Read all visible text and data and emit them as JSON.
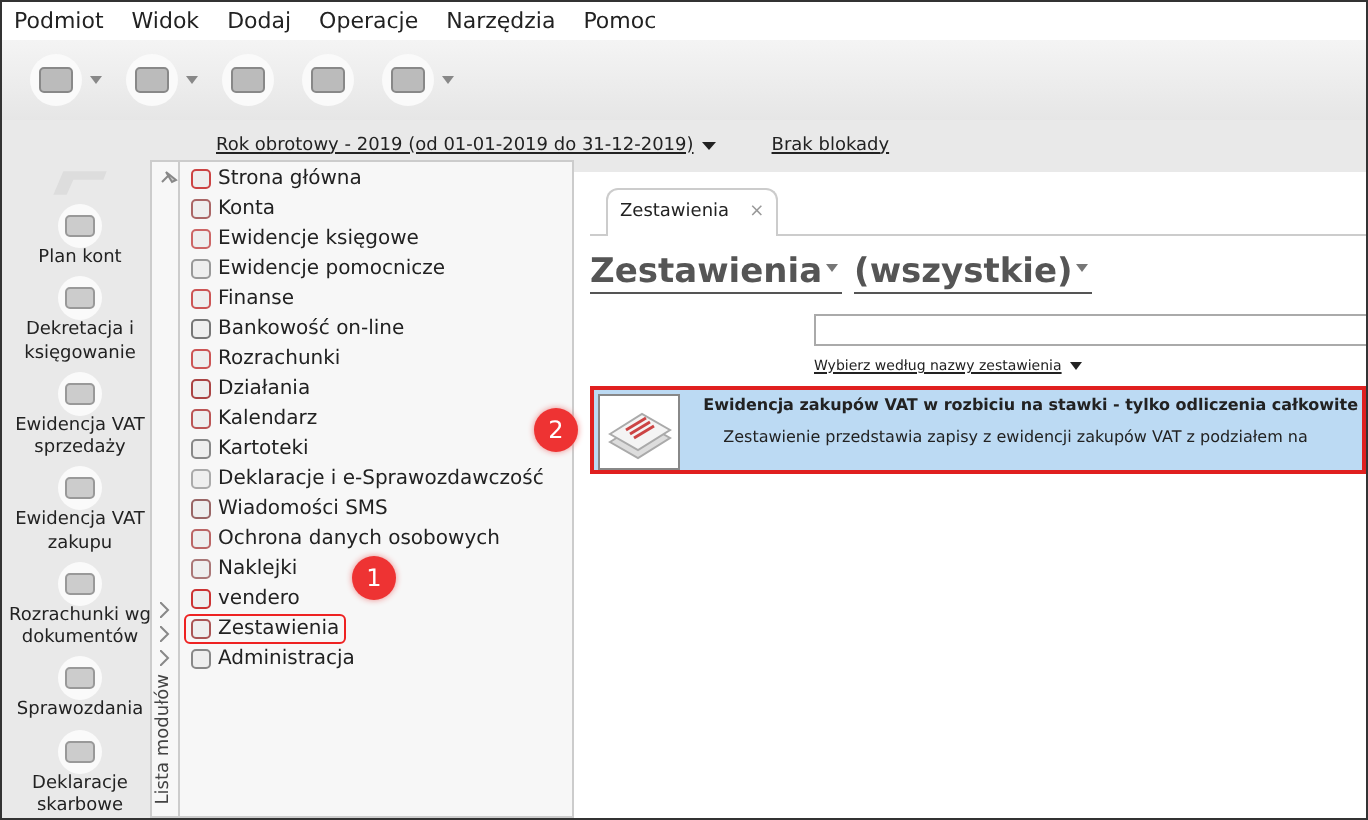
{
  "menu": [
    "Podmiot",
    "Widok",
    "Dodaj",
    "Operacje",
    "Narzędzia",
    "Pomoc"
  ],
  "toolbar": [
    {
      "has_menu": true
    },
    {
      "has_menu": true
    },
    {
      "has_menu": false
    },
    {
      "has_menu": false
    },
    {
      "has_menu": true
    }
  ],
  "shortcuts": [
    "Plan kont",
    "Dekretacja i księgowanie",
    "Ewidencja VAT sprzedaży",
    "Ewidencja VAT zakupu",
    "Rozrachunki wg dokumentów",
    "Sprawozdania",
    "Deklaracje skarbowe"
  ],
  "period": {
    "label": "Rok obrotowy - 2019  (od 01-01-2019 do 31-12-2019)",
    "lock": "Brak blokady"
  },
  "modules": {
    "title": "Lista modułów",
    "items": [
      {
        "label": "Strona główna",
        "selected": false
      },
      {
        "label": "Konta",
        "selected": false
      },
      {
        "label": "Ewidencje księgowe",
        "selected": false
      },
      {
        "label": "Ewidencje pomocnicze",
        "selected": false
      },
      {
        "label": "Finanse",
        "selected": false
      },
      {
        "label": "Bankowość on-line",
        "selected": false
      },
      {
        "label": "Rozrachunki",
        "selected": false
      },
      {
        "label": "Działania",
        "selected": false
      },
      {
        "label": "Kalendarz",
        "selected": false
      },
      {
        "label": "Kartoteki",
        "selected": false
      },
      {
        "label": "Deklaracje i e-Sprawozdawczość",
        "selected": false
      },
      {
        "label": "Wiadomości SMS",
        "selected": false
      },
      {
        "label": "Ochrona danych osobowych",
        "selected": false
      },
      {
        "label": "Naklejki",
        "selected": false
      },
      {
        "label": "vendero",
        "selected": false
      },
      {
        "label": "Zestawienia",
        "selected": true
      },
      {
        "label": "Administracja",
        "selected": false
      }
    ]
  },
  "tabs": [
    {
      "label": "Zestawienia",
      "selected": true,
      "close": "×"
    }
  ],
  "heading": [
    "Zestawienia",
    "(wszystkie)"
  ],
  "filter_link": "Wybierz według nazwy zestawienia",
  "reports": [
    {
      "title": "Ewidencja zakupów VAT w rozbiciu na stawki - tylko odliczenia całkowite",
      "description": "Zestawienie przedstawia zapisy z ewidencji zakupów VAT z podziałem na",
      "selected": true
    }
  ],
  "annotations": [
    {
      "number": "1"
    },
    {
      "number": "2"
    }
  ]
}
